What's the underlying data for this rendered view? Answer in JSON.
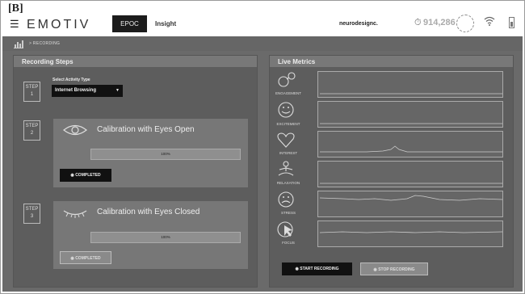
{
  "figure_label": "[B]",
  "topbar": {
    "logo": "EMOTIV",
    "tabs": [
      {
        "label": "EPOC",
        "active": true
      },
      {
        "label": "Insight",
        "active": false
      }
    ],
    "brand": "neurodesignc.",
    "timer_value": "914,286",
    "icons": [
      "menu-icon",
      "timer-icon",
      "headset-icon",
      "wifi-icon",
      "battery-icon"
    ]
  },
  "breadcrumb": {
    "text": "> RECORDING"
  },
  "recording_steps": {
    "title": "Recording Steps",
    "step1": {
      "badge_word": "STEP",
      "badge_num": "1",
      "select_label": "Select Activity Type",
      "select_value": "Internet Browsing"
    },
    "step2": {
      "badge_word": "STEP",
      "badge_num": "2",
      "title": "Calibration with Eyes Open",
      "progress_text": "100%",
      "progress": 1.0,
      "button": "COMPLETED"
    },
    "step3": {
      "badge_word": "STEP",
      "badge_num": "3",
      "title": "Calibration with Eyes Closed",
      "progress_text": "100%",
      "progress": 1.0,
      "button": "COMPLETED"
    }
  },
  "live_metrics": {
    "title": "Live Metrics",
    "metrics": [
      {
        "label": "ENGAGEMENT",
        "icon": "engagement-icon"
      },
      {
        "label": "EXCITEMENT",
        "icon": "excitement-icon"
      },
      {
        "label": "INTEREST",
        "icon": "interest-icon"
      },
      {
        "label": "RELAXATION",
        "icon": "relaxation-icon"
      },
      {
        "label": "STRESS",
        "icon": "stress-icon"
      },
      {
        "label": "FOCUS",
        "icon": "focus-icon"
      }
    ],
    "start_button": "START RECORDING",
    "stop_button": "STOP RECORDING"
  },
  "colors": {
    "app_bg": "#6a6a6a",
    "panel_bg": "#5d5d5d",
    "header_bg": "#787878",
    "active_tab": "#1c1c1c"
  }
}
